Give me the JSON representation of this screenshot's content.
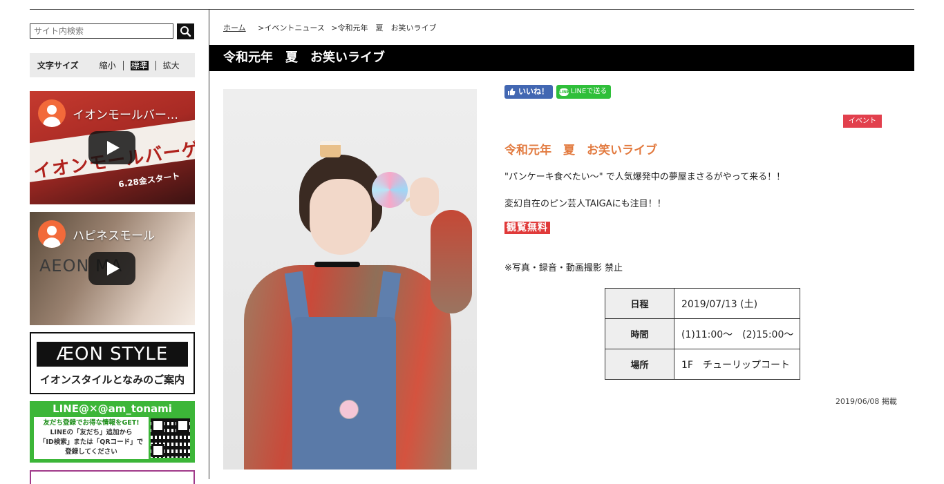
{
  "search": {
    "placeholder": "サイト内検索"
  },
  "font_size": {
    "label": "文字サイズ",
    "options": [
      "縮小",
      "標準",
      "拡大"
    ],
    "active": "標準"
  },
  "sidebar": {
    "videos": [
      {
        "title": "イオンモールバー…",
        "overlay_text": "イオンモールバーゲン",
        "extra": "6.28金スタート"
      },
      {
        "title": "ハピネスモール",
        "overlay_text": "AEON MA"
      }
    ],
    "aeon_style": {
      "logo": "ÆON STYLE",
      "subtitle": "イオンスタイルとなみのご案内"
    },
    "line_banner": {
      "heading": "LINE@✕@am_tonami",
      "lines": [
        "友だち登録でお得な情報をGET!",
        "LINEの「友だち」追加から",
        "「ID検索」または「QRコード」で",
        "登録してください"
      ]
    }
  },
  "breadcrumb": {
    "home": "ホーム",
    "items": [
      ">イベントニュース",
      ">令和元年　夏　お笑いライブ"
    ]
  },
  "page_title": "令和元年　夏　お笑いライブ",
  "social": {
    "like": "いいね！",
    "line": "LINEで送る",
    "line_icon": "LINE"
  },
  "tag": "イベント",
  "event": {
    "title": "令和元年　夏　お笑いライブ",
    "desc1": "\"パンケーキ食べたい〜\" で人気爆発中の夢屋まさるがやって来る！！",
    "desc2": "変幻自在のピン芸人TAIGAにも注目！！",
    "free_label": "観覧無料",
    "note": "※写真・録音・動画撮影 禁止",
    "details": [
      {
        "label": "日程",
        "value": "2019/07/13 (土)"
      },
      {
        "label": "時間",
        "value": "(1)11:00〜　(2)15:00〜"
      },
      {
        "label": "場所",
        "value": "1F　チューリップコート"
      }
    ],
    "posted": "2019/06/08 掲載"
  },
  "colors": {
    "accent_orange": "#e27a3f",
    "tag_red": "#e2404d",
    "title_bar": "#000000",
    "fb_blue": "#4267b2",
    "line_green": "#3cb638"
  }
}
